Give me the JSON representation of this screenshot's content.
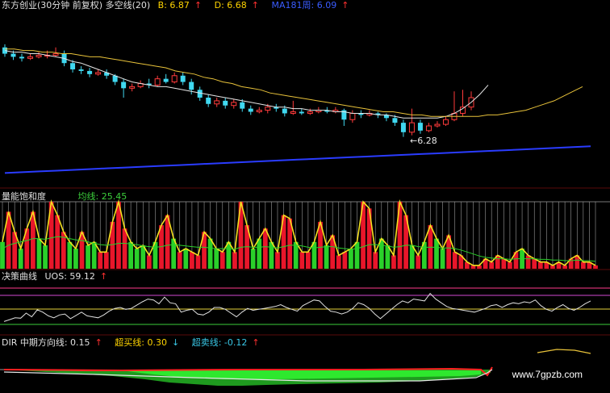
{
  "header1": {
    "title": "东方创业(30分钟 前复权) 多空线(20)",
    "b_label": "B: 6.87",
    "d_label": "D: 6.68",
    "ma_label": "MA181周: 6.09",
    "up_arrow": "↑"
  },
  "low_annotation": "←6.28",
  "header2": {
    "title": "量能饱和度",
    "ma_label": "均线: 25.45"
  },
  "header3": {
    "title": "决策曲线",
    "uos_label": "UOS: 59.12",
    "up_arrow": "↑"
  },
  "header4": {
    "dir_label": "DIR  中期方向线: 0.15",
    "buy_label": "超买线: 0.30",
    "sell_label": "超卖线: -0.12",
    "up_arrow": "↑",
    "down_arrow": "↓"
  },
  "watermark": "www.7gpzb.com",
  "colors": {
    "up_candle": "#ff3b3b",
    "down_candle": "#40d8f0",
    "ma_white": "#e6e6e6",
    "ma_yellow": "#e8c23a",
    "ma_blue": "#2a3cff",
    "sat_red": "#e8162a",
    "sat_green": "#2ad02a",
    "sat_yellow": "#f5e020",
    "uos_line": "#e0e0e0"
  },
  "chart_data": [
    {
      "type": "candlestick",
      "candles": [
        [
          6.72,
          6.68,
          6.74,
          6.66
        ],
        [
          6.68,
          6.66,
          6.7,
          6.64
        ],
        [
          6.66,
          6.65,
          6.68,
          6.63
        ],
        [
          6.65,
          6.66,
          6.68,
          6.64
        ],
        [
          6.66,
          6.67,
          6.69,
          6.65
        ],
        [
          6.67,
          6.67,
          6.7,
          6.65
        ],
        [
          6.67,
          6.68,
          6.72,
          6.66
        ],
        [
          6.68,
          6.62,
          6.7,
          6.6
        ],
        [
          6.62,
          6.58,
          6.64,
          6.56
        ],
        [
          6.58,
          6.57,
          6.6,
          6.55
        ],
        [
          6.57,
          6.55,
          6.59,
          6.53
        ],
        [
          6.55,
          6.56,
          6.58,
          6.54
        ],
        [
          6.56,
          6.54,
          6.58,
          6.52
        ],
        [
          6.54,
          6.5,
          6.55,
          6.48
        ],
        [
          6.5,
          6.46,
          6.52,
          6.4
        ],
        [
          6.46,
          6.47,
          6.49,
          6.44
        ],
        [
          6.47,
          6.49,
          6.51,
          6.46
        ],
        [
          6.49,
          6.48,
          6.52,
          6.46
        ],
        [
          6.48,
          6.52,
          6.54,
          6.47
        ],
        [
          6.52,
          6.5,
          6.55,
          6.49
        ],
        [
          6.5,
          6.54,
          6.56,
          6.49
        ],
        [
          6.54,
          6.5,
          6.56,
          6.48
        ],
        [
          6.5,
          6.45,
          6.52,
          6.42
        ],
        [
          6.45,
          6.4,
          6.47,
          6.38
        ],
        [
          6.4,
          6.36,
          6.42,
          6.34
        ],
        [
          6.36,
          6.38,
          6.4,
          6.34
        ],
        [
          6.38,
          6.35,
          6.4,
          6.33
        ],
        [
          6.35,
          6.37,
          6.39,
          6.33
        ],
        [
          6.37,
          6.33,
          6.39,
          6.31
        ],
        [
          6.33,
          6.31,
          6.35,
          6.29
        ],
        [
          6.31,
          6.32,
          6.34,
          6.3
        ],
        [
          6.32,
          6.34,
          6.36,
          6.3
        ],
        [
          6.34,
          6.33,
          6.36,
          6.31
        ],
        [
          6.33,
          6.3,
          6.35,
          6.28
        ],
        [
          6.3,
          6.31,
          6.38,
          6.29
        ],
        [
          6.31,
          6.3,
          6.33,
          6.29
        ],
        [
          6.3,
          6.31,
          6.33,
          6.29
        ],
        [
          6.31,
          6.32,
          6.34,
          6.3
        ],
        [
          6.32,
          6.31,
          6.34,
          6.3
        ],
        [
          6.31,
          6.32,
          6.34,
          6.3
        ],
        [
          6.32,
          6.26,
          6.33,
          6.22
        ],
        [
          6.26,
          6.3,
          6.32,
          6.24
        ],
        [
          6.3,
          6.29,
          6.32,
          6.27
        ],
        [
          6.29,
          6.3,
          6.32,
          6.28
        ],
        [
          6.3,
          6.29,
          6.31,
          6.27
        ],
        [
          6.29,
          6.27,
          6.3,
          6.25
        ],
        [
          6.27,
          6.24,
          6.29,
          6.22
        ],
        [
          6.24,
          6.18,
          6.26,
          6.15
        ],
        [
          6.18,
          6.24,
          6.33,
          6.16
        ],
        [
          6.24,
          6.19,
          6.26,
          6.17
        ],
        [
          6.19,
          6.22,
          6.24,
          6.18
        ],
        [
          6.22,
          6.23,
          6.25,
          6.21
        ],
        [
          6.23,
          6.26,
          6.28,
          6.22
        ],
        [
          6.26,
          6.3,
          6.44,
          6.25
        ],
        [
          6.3,
          6.34,
          6.45,
          6.28
        ],
        [
          6.34,
          6.4,
          6.44,
          6.32
        ]
      ],
      "ma_white": [
        6.7,
        6.69,
        6.69,
        6.68,
        6.68,
        6.67,
        6.66,
        6.65,
        6.63,
        6.62,
        6.6,
        6.58,
        6.56,
        6.54,
        6.52,
        6.5,
        6.49,
        6.48,
        6.47,
        6.47,
        6.46,
        6.45,
        6.44,
        6.43,
        6.42,
        6.41,
        6.4,
        6.39,
        6.38,
        6.37,
        6.36,
        6.35,
        6.34,
        6.34,
        6.33,
        6.33,
        6.32,
        6.32,
        6.32,
        6.31,
        6.31,
        6.3,
        6.3,
        6.3,
        6.29,
        6.29,
        6.28,
        6.27,
        6.27,
        6.27,
        6.27,
        6.27,
        6.28,
        6.3,
        6.33,
        6.37,
        6.42,
        6.48
      ],
      "ma_yellow": [
        6.71,
        6.71,
        6.7,
        6.7,
        6.69,
        6.69,
        6.68,
        6.68,
        6.67,
        6.66,
        6.66,
        6.65,
        6.64,
        6.63,
        6.62,
        6.61,
        6.6,
        6.59,
        6.57,
        6.56,
        6.55,
        6.53,
        6.52,
        6.5,
        6.49,
        6.47,
        6.46,
        6.45,
        6.43,
        6.42,
        6.41,
        6.4,
        6.39,
        6.38,
        6.37,
        6.36,
        6.35,
        6.34,
        6.33,
        6.32,
        6.31,
        6.31,
        6.3,
        6.29,
        6.29,
        6.28,
        6.28,
        6.28,
        6.28,
        6.28,
        6.28,
        6.29,
        6.29,
        6.3,
        6.31,
        6.32,
        6.34,
        6.36,
        6.38,
        6.41,
        6.44,
        6.47
      ],
      "ma_blue": [
        5.92,
        5.925,
        5.93,
        5.935,
        5.94,
        5.945,
        5.95,
        5.955,
        5.96,
        5.965,
        5.97,
        5.975,
        5.98,
        5.985,
        5.99,
        5.995,
        6.0,
        6.005,
        6.01,
        6.015,
        6.02,
        6.025,
        6.03,
        6.035,
        6.04,
        6.045,
        6.05,
        6.055,
        6.06,
        6.065,
        6.07,
        6.075,
        6.08,
        6.085,
        6.09
      ],
      "ylim": [
        5.85,
        6.95
      ]
    },
    {
      "type": "bar",
      "values": [
        40,
        85,
        55,
        30,
        60,
        85,
        45,
        35,
        100,
        80,
        55,
        40,
        30,
        55,
        35,
        40,
        25,
        25,
        70,
        100,
        60,
        40,
        30,
        35,
        20,
        40,
        65,
        80,
        45,
        25,
        30,
        25,
        20,
        55,
        45,
        30,
        25,
        40,
        25,
        100,
        65,
        30,
        45,
        60,
        40,
        25,
        80,
        75,
        40,
        25,
        25,
        40,
        70,
        35,
        50,
        20,
        25,
        30,
        40,
        100,
        90,
        25,
        45,
        35,
        20,
        100,
        80,
        35,
        20,
        40,
        65,
        45,
        30,
        50,
        25,
        20,
        10,
        5,
        5,
        15,
        10,
        20,
        15,
        10,
        25,
        30,
        20,
        15,
        10,
        10,
        5,
        10,
        5,
        15,
        20,
        10,
        10,
        5
      ],
      "ma": [
        30,
        35,
        38,
        40,
        42,
        45,
        45,
        44,
        46,
        48,
        47,
        45,
        43,
        42,
        40,
        38,
        36,
        35,
        36,
        38,
        38,
        37,
        36,
        34,
        33,
        32,
        33,
        35,
        36,
        35,
        34,
        33,
        32,
        32,
        31,
        30,
        30,
        30,
        29,
        32,
        33,
        32,
        32,
        33,
        32,
        31,
        33,
        35,
        35,
        34,
        32,
        31,
        32,
        33,
        33,
        31,
        30,
        29,
        30,
        33,
        36,
        36,
        35,
        34,
        32,
        33,
        35,
        35,
        33,
        32,
        32,
        32,
        31,
        31,
        30,
        28,
        25,
        22,
        19,
        17,
        16,
        15,
        15,
        14,
        15,
        15,
        15,
        15,
        14,
        14,
        13,
        13,
        12,
        12,
        13,
        12,
        12,
        11
      ],
      "ylim": [
        0,
        100
      ]
    },
    {
      "type": "line",
      "values": [
        20,
        24,
        28,
        27,
        38,
        30,
        45,
        40,
        32,
        28,
        34,
        36,
        26,
        33,
        40,
        32,
        30,
        28,
        34,
        42,
        48,
        50,
        46,
        48,
        55,
        62,
        68,
        66,
        58,
        72,
        60,
        58,
        40,
        44,
        46,
        36,
        34,
        40,
        50,
        50,
        46,
        38,
        30,
        40,
        48,
        44,
        46,
        48,
        50,
        52,
        56,
        50,
        46,
        42,
        54,
        60,
        66,
        64,
        52,
        42,
        40,
        36,
        40,
        48,
        60,
        56,
        48,
        36,
        26,
        36,
        46,
        56,
        64,
        60,
        68,
        66,
        64,
        80,
        68,
        60,
        52,
        48,
        46,
        44,
        42,
        40,
        44,
        48,
        54,
        56,
        50,
        56,
        60,
        58,
        62,
        60,
        66,
        54,
        46,
        42,
        50,
        56,
        48,
        44,
        50,
        58,
        64
      ],
      "ylim": [
        0,
        100
      ]
    }
  ]
}
